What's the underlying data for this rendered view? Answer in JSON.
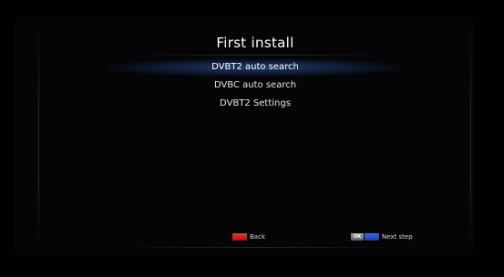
{
  "header": {
    "title": "First install"
  },
  "menu": {
    "items": [
      {
        "label": "DVBT2 auto search",
        "selected": true
      },
      {
        "label": "DVBC auto search",
        "selected": false
      },
      {
        "label": "DVBT2 Settings",
        "selected": false
      }
    ]
  },
  "footer": {
    "back_label": "Back",
    "ok_key_label": "OK",
    "next_label": "Next step"
  },
  "colors": {
    "background": "#000000",
    "selection_highlight": "#28468a",
    "red_key": "#d22a2a",
    "blue_key": "#2a55cc",
    "ok_key": "#80868e"
  }
}
